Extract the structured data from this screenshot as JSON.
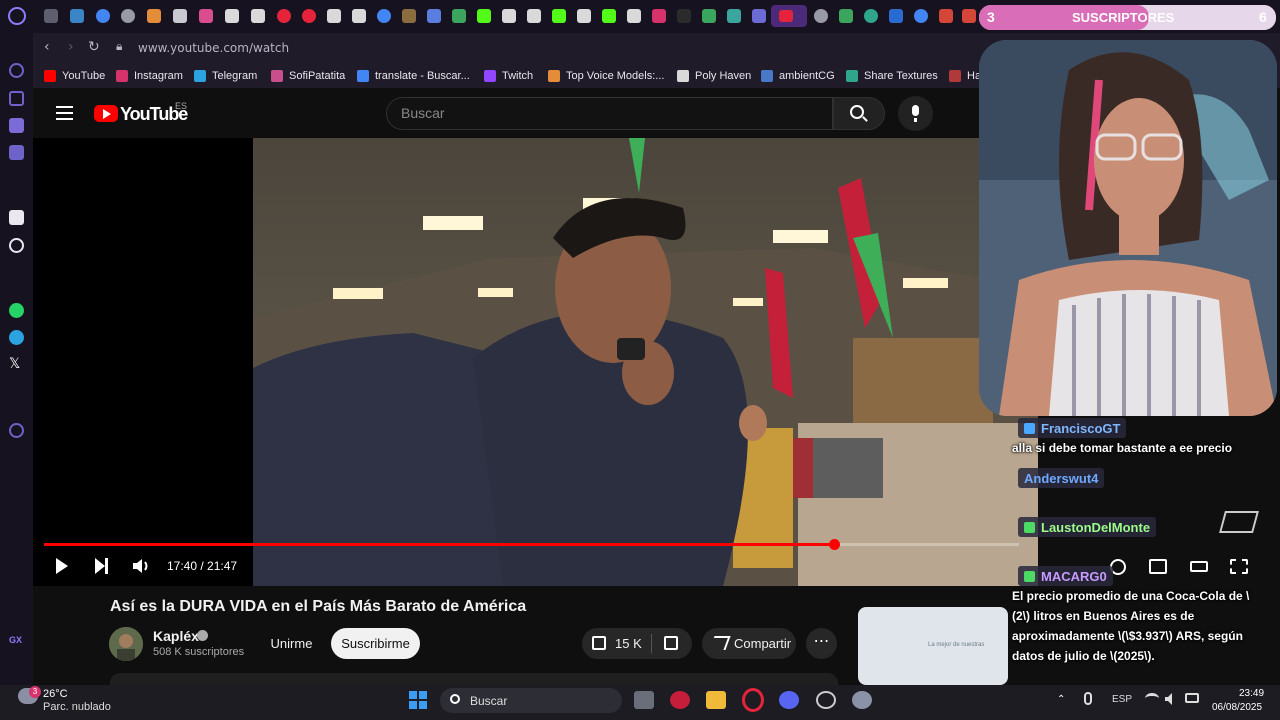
{
  "browser": {
    "url": "www.youtube.com/watch",
    "bookmarks": [
      {
        "label": "YouTube",
        "color": "#ff0000"
      },
      {
        "label": "Instagram",
        "color": "#d6336c"
      },
      {
        "label": "Telegram",
        "color": "#2aa3e0"
      },
      {
        "label": "SofiPatatita",
        "color": "#c94f8c"
      },
      {
        "label": "translate - Buscar...",
        "color": "#4285f4"
      },
      {
        "label": "Twitch",
        "color": "#9146ff"
      },
      {
        "label": "Top Voice Models:...",
        "color": "#e58c3a"
      },
      {
        "label": "Poly Haven",
        "color": "#d9d9d9"
      },
      {
        "label": "ambientCG",
        "color": "#4a78c8"
      },
      {
        "label": "Share Textures",
        "color": "#2fa58c"
      },
      {
        "label": "Hai",
        "color": "#b03a3a"
      }
    ],
    "sidebar_label": "GX"
  },
  "youtube": {
    "logo_text": "YouTube",
    "country_code": "ES",
    "search_placeholder": "Buscar",
    "player": {
      "current_time": "17:40",
      "duration": "21:47",
      "time_text": "17:40 / 21:47",
      "progress_fraction": 0.81
    },
    "video_title": "Así es la DURA VIDA en el País Más Barato de América",
    "channel_name": "Kapléx",
    "subscribers": "508 K suscriptores",
    "join_label": "Unirme",
    "subscribe_label": "Suscribirme",
    "like_count": "15 K",
    "share_label": "Compartir",
    "more_label": "⋯",
    "rec_thumb_text": "La mejor de nuestras"
  },
  "stream_overlay": {
    "subs_goal_left": "3",
    "subs_label": "SUSCRIPTORES",
    "subs_goal_right": "6",
    "chat": [
      {
        "user": "FranciscoGT",
        "color": "#7fb6ff",
        "badge_color": "#4aa8ff",
        "message": "alla si debe tomar bastante a ee precio"
      },
      {
        "user": "Anderswut4",
        "color": "#6fa8ff",
        "badge_color": "",
        "message": ""
      },
      {
        "user": "LaustonDelMonte",
        "color": "#9dfb8a",
        "badge_color": "#4cd964",
        "message": ""
      },
      {
        "user": "MACARG0",
        "color": "#c79bff",
        "badge_color": "#4cd964",
        "message": "El precio promedio de una Coca-Cola de \\(2\\) litros en Buenos Aires es de aproximadamente \\(\\$3.937\\) ARS, según datos de julio de \\(2025\\)."
      }
    ]
  },
  "taskbar": {
    "weather_badge": "3",
    "temperature": "26°C",
    "weather_desc": "Parc. nublado",
    "search_label": "Buscar",
    "tray_lang": "ESP",
    "time": "23:49",
    "date": "06/08/2025"
  }
}
